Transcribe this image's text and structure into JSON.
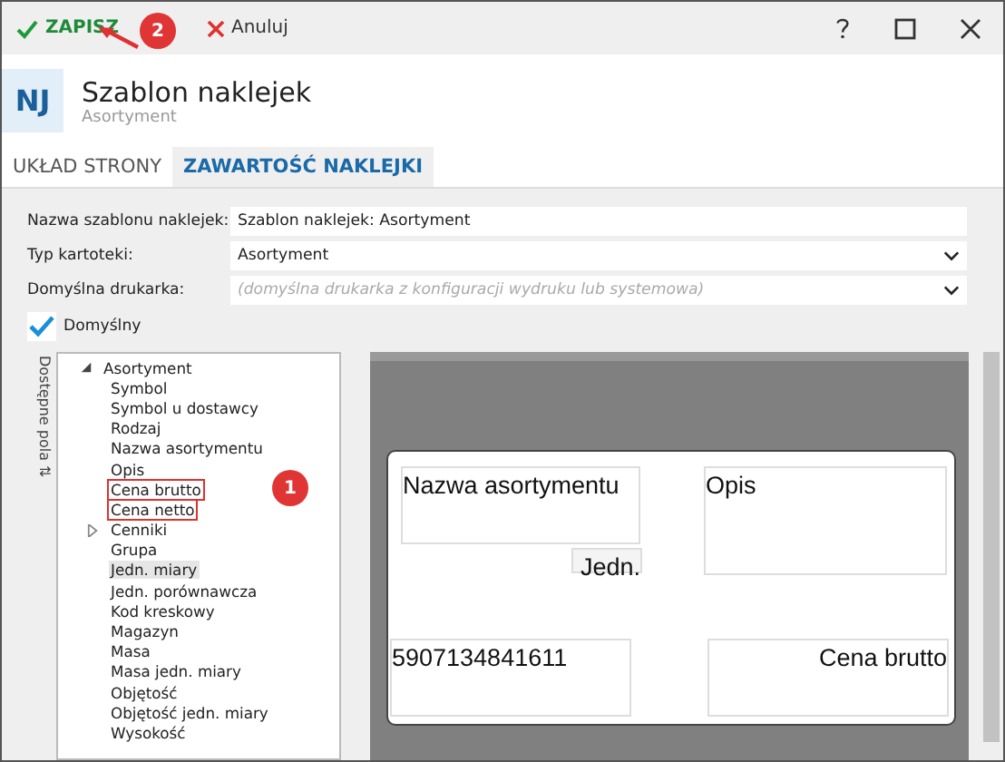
{
  "toolbar": {
    "save": "ZAPISZ",
    "cancel": "Anuluj"
  },
  "header": {
    "initials": "NJ",
    "title": "Szablon naklejek",
    "subtitle": "Asortyment"
  },
  "tabs": [
    {
      "label": "UKŁAD STRONY",
      "selected": false
    },
    {
      "label": "ZAWARTOŚĆ NAKLEJKI",
      "selected": true
    }
  ],
  "form": {
    "fields": [
      {
        "label": "Nazwa szablonu naklejek:",
        "kind": "text",
        "value": "Szablon naklejek: Asortyment"
      },
      {
        "label": "Typ kartoteki:",
        "kind": "select",
        "value": "Asortyment"
      },
      {
        "label": "Domyślna drukarka:",
        "kind": "select",
        "placeholder": "(domyślna drukarka z konfiguracji wydruku lub systemowa)"
      }
    ],
    "default_checkbox": {
      "label": "Domyślny",
      "checked": true
    }
  },
  "fields_panel": {
    "title": "Dostępne pola ⇅",
    "tree": [
      {
        "label": "Asortyment",
        "expanded": true,
        "selected": false,
        "children": [
          {
            "label": "Symbol",
            "selected": false
          },
          {
            "label": "Symbol u dostawcy",
            "selected": false
          },
          {
            "label": "Rodzaj",
            "selected": false
          },
          {
            "label": "Nazwa asortymentu",
            "selected": false
          },
          {
            "label": "Opis",
            "selected": false
          },
          {
            "label": "Cena brutto",
            "selected": false,
            "highlighted": true
          },
          {
            "label": "Cena netto",
            "selected": false,
            "highlighted": true
          },
          {
            "label": "Cenniki",
            "selected": false,
            "expanded": false
          },
          {
            "label": "Grupa",
            "selected": false
          },
          {
            "label": "Jedn. miary",
            "selected": true
          },
          {
            "label": "Jedn. porównawcza",
            "selected": false
          },
          {
            "label": "Kod kreskowy",
            "selected": false
          },
          {
            "label": "Magazyn",
            "selected": false
          },
          {
            "label": "Masa",
            "selected": false
          },
          {
            "label": "Masa jedn. miary",
            "selected": false
          },
          {
            "label": "Objętość",
            "selected": false
          },
          {
            "label": "Objętość jedn. miary",
            "selected": false
          },
          {
            "label": "Wysokość",
            "selected": false
          }
        ]
      }
    ]
  },
  "label_preview": {
    "fields": [
      {
        "text": "Nazwa asortymentu"
      },
      {
        "text": "Jedn."
      },
      {
        "text": "Opis"
      },
      {
        "text": "5907134841611"
      },
      {
        "text": "Cena brutto"
      }
    ]
  },
  "annotations": [
    {
      "number": "1"
    },
    {
      "number": "2"
    }
  ]
}
